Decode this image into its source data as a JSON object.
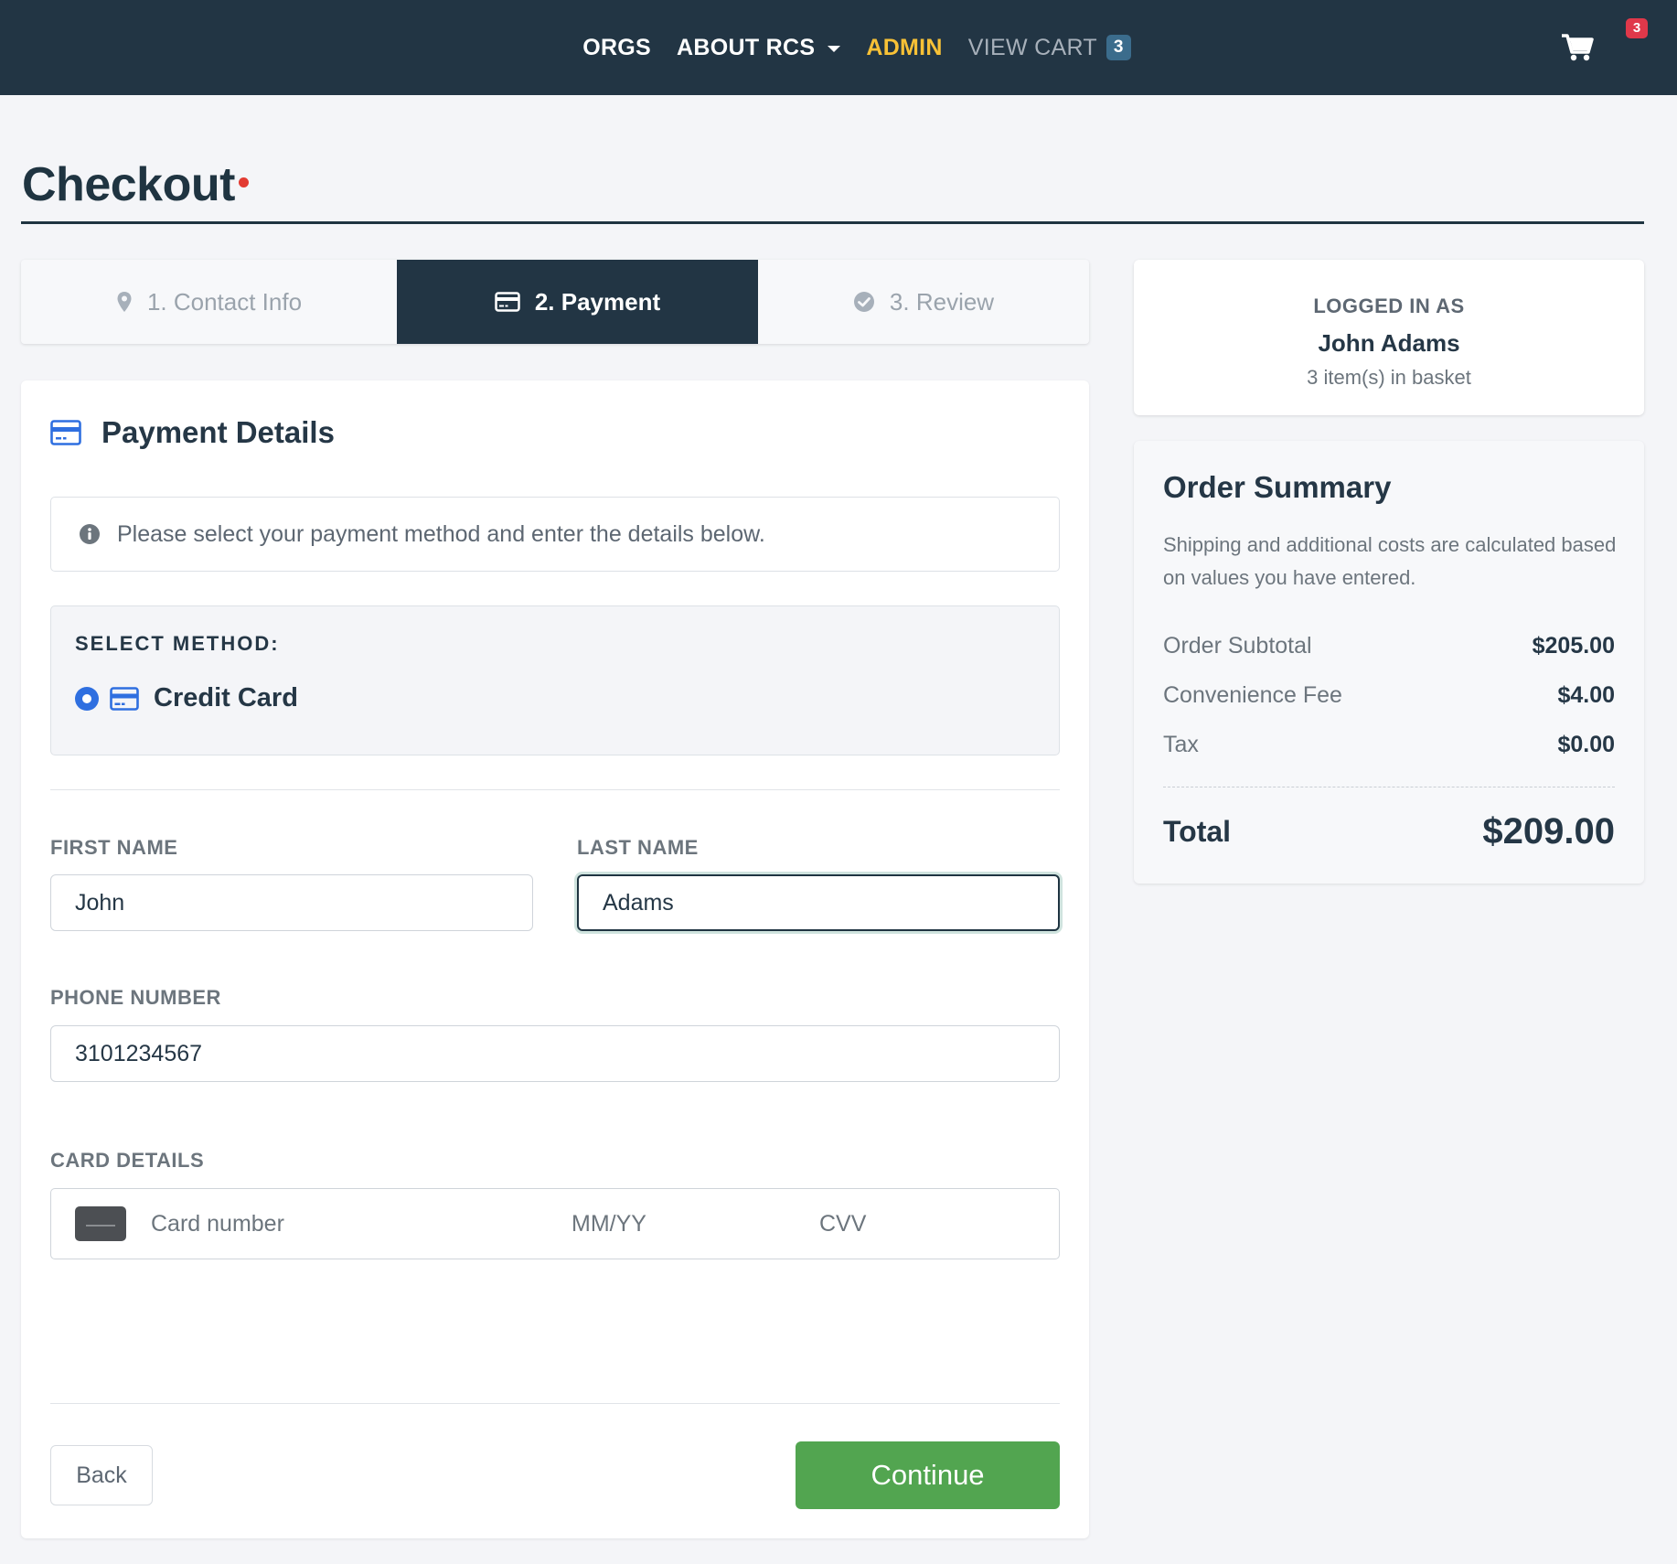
{
  "nav": {
    "items": [
      {
        "label": "ORGS"
      },
      {
        "label": "ABOUT RCS"
      },
      {
        "label": "ADMIN"
      },
      {
        "label": "VIEW CART"
      }
    ],
    "view_cart_count": "3",
    "cart_icon": "cart-icon",
    "cart_badge": "3",
    "admin_color": "#f7c136"
  },
  "page": {
    "title": "Checkout"
  },
  "steps": [
    {
      "label": "1. Contact Info",
      "icon": "map-pin-icon",
      "active": false
    },
    {
      "label": "2. Payment",
      "icon": "credit-card-icon",
      "active": true
    },
    {
      "label": "3. Review",
      "icon": "check-circle-icon",
      "active": false
    }
  ],
  "payment": {
    "title": "Payment Details",
    "info": "Please select your payment method and enter the details below.",
    "method_label": "SELECT METHOD:",
    "method_option": "Credit Card",
    "first_name_label": "FIRST NAME",
    "first_name_value": "John",
    "last_name_label": "LAST NAME",
    "last_name_value": "Adams",
    "phone_label": "PHONE NUMBER",
    "phone_value": "3101234567",
    "card_label": "CARD DETAILS",
    "card_number_placeholder": "Card number",
    "expiry_placeholder": "MM/YY",
    "cvv_placeholder": "CVV",
    "back_label": "Back",
    "continue_label": "Continue",
    "continue_color": "#52a550",
    "accent_color": "#2f6fe0"
  },
  "login": {
    "label": "LOGGED IN AS",
    "name": "John Adams",
    "basket": "3 item(s) in basket"
  },
  "summary": {
    "title": "Order Summary",
    "description": "Shipping and additional costs are calculated based on values you have entered.",
    "rows": [
      {
        "label": "Order Subtotal",
        "value": "$205.00"
      },
      {
        "label": "Convenience Fee",
        "value": "$4.00"
      },
      {
        "label": "Tax",
        "value": "$0.00"
      }
    ],
    "total_label": "Total",
    "total_value": "$209.00"
  }
}
